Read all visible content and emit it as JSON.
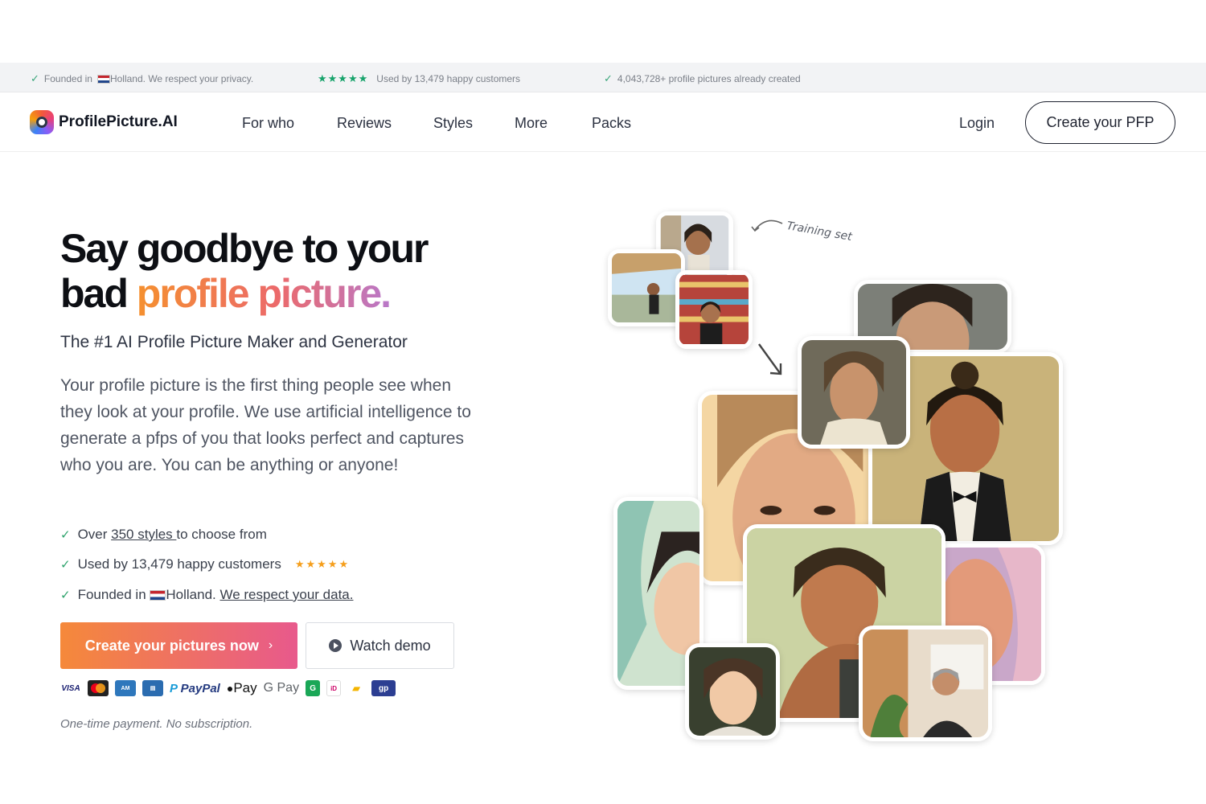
{
  "topbar": {
    "founded_prefix": "Founded in",
    "founded_suffix": "Holland. We respect your privacy.",
    "used_by": "Used by 13,479 happy customers",
    "created": "4,043,728+ profile pictures already created",
    "stars": "★★★★★"
  },
  "nav": {
    "logo": "ProfilePicture.AI",
    "links": [
      "For who",
      "Reviews",
      "Styles",
      "More",
      "Packs"
    ],
    "login": "Login",
    "cta": "Create your PFP"
  },
  "hero": {
    "title_line1": "Say goodbye to your",
    "title_line2_plain": "bad ",
    "title_line2_gradient": "profile picture.",
    "subtitle": "The #1 AI Profile Picture Maker and Generator",
    "description": "Your profile picture is the first thing people see when they look at your profile. We use artificial intelligence to generate a pfps of you that looks perfect and captures who you are. You can be anything or anyone!",
    "bullets": {
      "b1_pre": "Over ",
      "b1_link": "350 styles ",
      "b1_post": "to choose from",
      "b2": "Used by 13,479 happy customers",
      "b2_stars": "★★★★★",
      "b3_pre": "Founded in ",
      "b3_mid": "Holland. ",
      "b3_link": "We respect your data."
    },
    "primary_button": "Create your pictures now",
    "secondary_button": "Watch demo",
    "payments": [
      "VISA",
      "PayPal",
      "Pay",
      "G Pay"
    ],
    "note": "One-time payment. No subscription."
  },
  "collage": {
    "annotation": "Training set"
  },
  "colors": {
    "accent_start": "#f5893a",
    "accent_end": "#e8598c",
    "check": "#2ea36c"
  }
}
